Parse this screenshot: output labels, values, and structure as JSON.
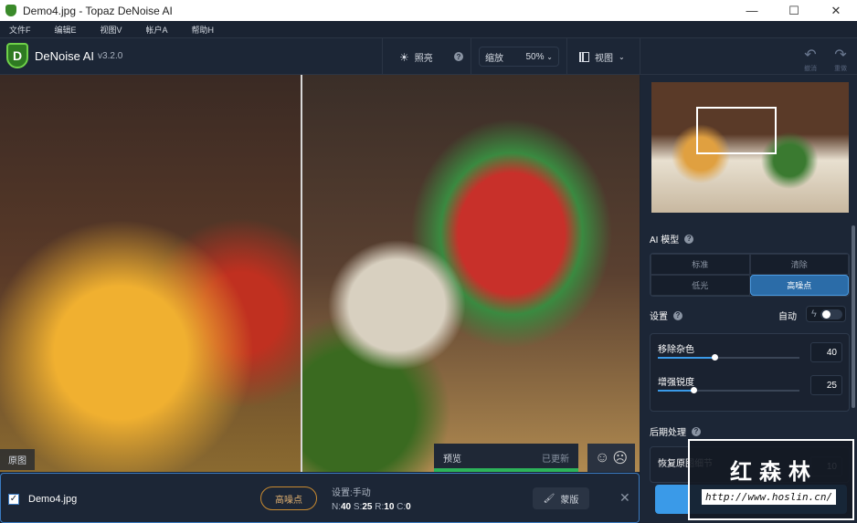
{
  "window": {
    "title": "Demo4.jpg - Topaz DeNoise AI",
    "minimize": "—",
    "maximize": "☐",
    "close": "✕"
  },
  "menu": [
    "文件F",
    "编辑E",
    "视图V",
    "帐户A",
    "帮助H"
  ],
  "app": {
    "name": "DeNoise AI",
    "version": "v3.2.0",
    "logo_letter": "D"
  },
  "toolbar": {
    "lighting": "照亮",
    "zoom_label": "缩放",
    "zoom_value": "50%",
    "view": "视图",
    "undo": "撤消",
    "redo": "重做"
  },
  "viewer": {
    "original_label": "原图",
    "preview_label": "预览",
    "preview_status": "已更新",
    "preview_progress": 1.0
  },
  "file": {
    "name": "Demo4.jpg",
    "checked": true,
    "model": "高噪点",
    "settings": "设置:手动",
    "stats": {
      "N": "40",
      "S": "25",
      "R": "10",
      "C": "0"
    },
    "mask": "蒙版"
  },
  "panel": {
    "ai_model_title": "AI 模型",
    "models": [
      {
        "label": "标准",
        "active": false
      },
      {
        "label": "清除",
        "active": false
      },
      {
        "label": "低光",
        "active": false
      },
      {
        "label": "高噪点",
        "active": true
      }
    ],
    "settings_title": "设置",
    "auto_label": "自动",
    "auto_on": false,
    "sliders": [
      {
        "label": "移除杂色",
        "value": 40
      },
      {
        "label": "增强锐度",
        "value": 25
      }
    ],
    "post_title": "后期处理",
    "recover": {
      "label": "恢复原图细节",
      "value": 10
    }
  },
  "watermark": {
    "text": "红森林",
    "url": "http://www.hoslin.cn/"
  }
}
